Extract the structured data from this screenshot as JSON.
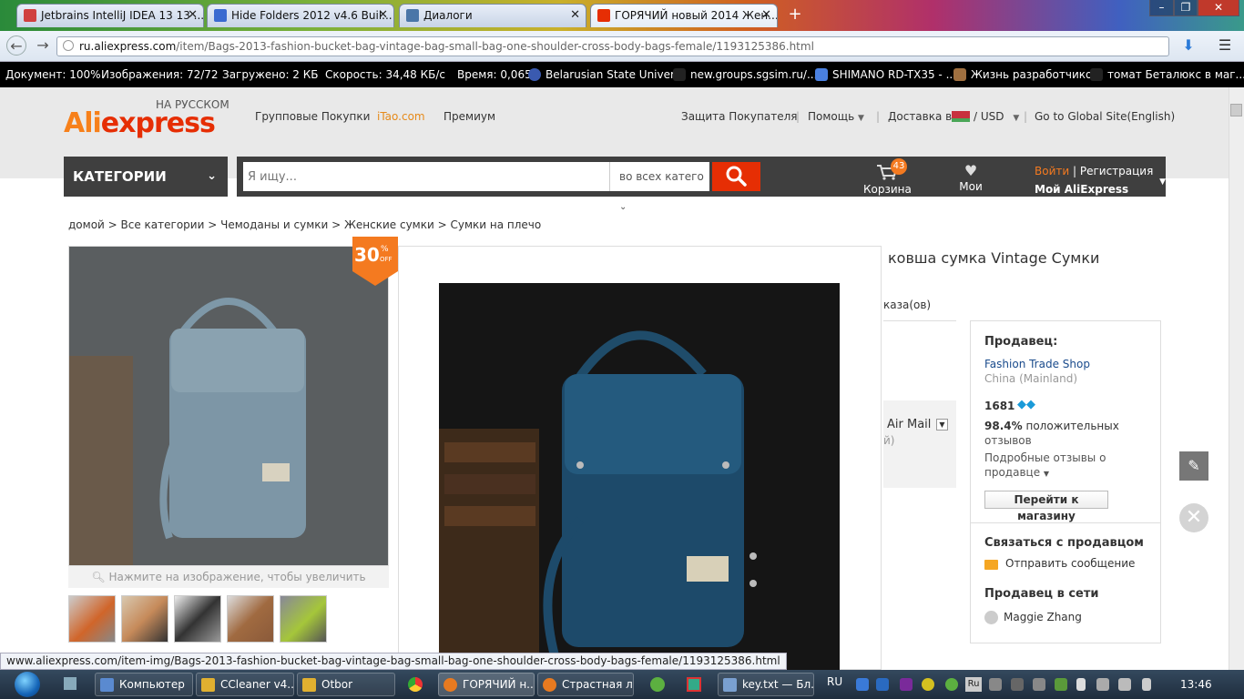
{
  "browser": {
    "tabs": [
      {
        "label": "Jetbrains IntelliJ IDEA 13 13 ...",
        "color": "#d04040"
      },
      {
        "label": "Hide Folders 2012 v4.6 Buil...",
        "color": "#3a6ad0"
      },
      {
        "label": "Диалоги",
        "color": "#4a76a8"
      },
      {
        "label": "ГОРЯЧИЙ новый 2014 Жен...",
        "color": "#e62e04"
      }
    ],
    "url_domain": "ru.aliexpress.com",
    "url_path": "/item/Bags-2013-fashion-bucket-bag-vintage-bag-small-bag-one-shoulder-cross-body-bags-female/1193125386.html"
  },
  "statusbar": {
    "document": "Документ: 100%",
    "images": "Изображения: 72/72",
    "loaded": "Загружено: 2 КБ",
    "speed": "Скорость: 34,48 КБ/с",
    "time": "Время: 0,065",
    "bookmarks": [
      "Belarusian State Univer...",
      "new.groups.sgsim.ru/...",
      "SHIMANO RD-TX35 - ...",
      "Жизнь разработчиков",
      "томат Беталюкс в маг..."
    ]
  },
  "site": {
    "logo_ali": "Ali",
    "logo_express": "express",
    "logo_sub": "НА РУССКОМ",
    "top_links": [
      "Групповые Покупки",
      "iTao.com",
      "Премиум"
    ],
    "buyer_protection": "Защита Покупателя",
    "help": "Помощь",
    "delivery": "Доставка в",
    "currency": "USD",
    "global_site": "Go to Global Site(English)",
    "categories": "КАТЕГОРИИ",
    "search_placeholder": "Я ищу...",
    "search_category": "во всех катего",
    "cart_label": "Корзина",
    "cart_count": "43",
    "wishlist_label": "Мои желания",
    "login": "Войти",
    "register": "Регистрация",
    "my_ali": "Мой AliExpress"
  },
  "breadcrumb": [
    "домой",
    "Все категории",
    "Чемоданы и сумки",
    "Женские сумки",
    "Сумки на плечо"
  ],
  "product": {
    "discount": "30",
    "discount_unit": "%",
    "discount_off": "OFF",
    "zoom_hint": "Нажмите на изображение, чтобы увеличить",
    "title": "ковша сумка Vintage Сумки",
    "orders_text": "каза(ов)",
    "shipping": "Air Mail",
    "shipping_sub": "й)"
  },
  "seller": {
    "heading": "Продавец:",
    "shop_name": "Fashion Trade Shop",
    "country": "China (Mainland)",
    "score": "1681",
    "positive_pct": "98.4%",
    "positive_text": "положительных",
    "reviews_word": "отзывов",
    "detailed_reviews": "Подробные отзывы о",
    "about_seller": "продавце",
    "store_button": "Перейти к магазину",
    "contact_heading": "Связаться с продавцом",
    "send_message": "Отправить сообщение",
    "online_heading": "Продавец в сети",
    "online_name": "Maggie Zhang"
  },
  "link_status": "www.aliexpress.com/item-img/Bags-2013-fashion-bucket-bag-vintage-bag-small-bag-one-shoulder-cross-body-bags-female/1193125386.html",
  "taskbar": {
    "items": [
      {
        "label": "Компьютер",
        "color": "#5a8ad0"
      },
      {
        "label": "CCleaner v4....",
        "color": "#e0b030"
      },
      {
        "label": "Otbor",
        "color": "#e0b030"
      },
      {
        "label": "ГОРЯЧИЙ н...",
        "color": "#e87a20"
      },
      {
        "label": "Страстная л...",
        "color": "#e87a20"
      },
      {
        "label": "key.txt — Бл...",
        "color": "#7aa0d0"
      }
    ],
    "lang": "RU",
    "tray_lang": "Ru",
    "clock": "13:46"
  }
}
